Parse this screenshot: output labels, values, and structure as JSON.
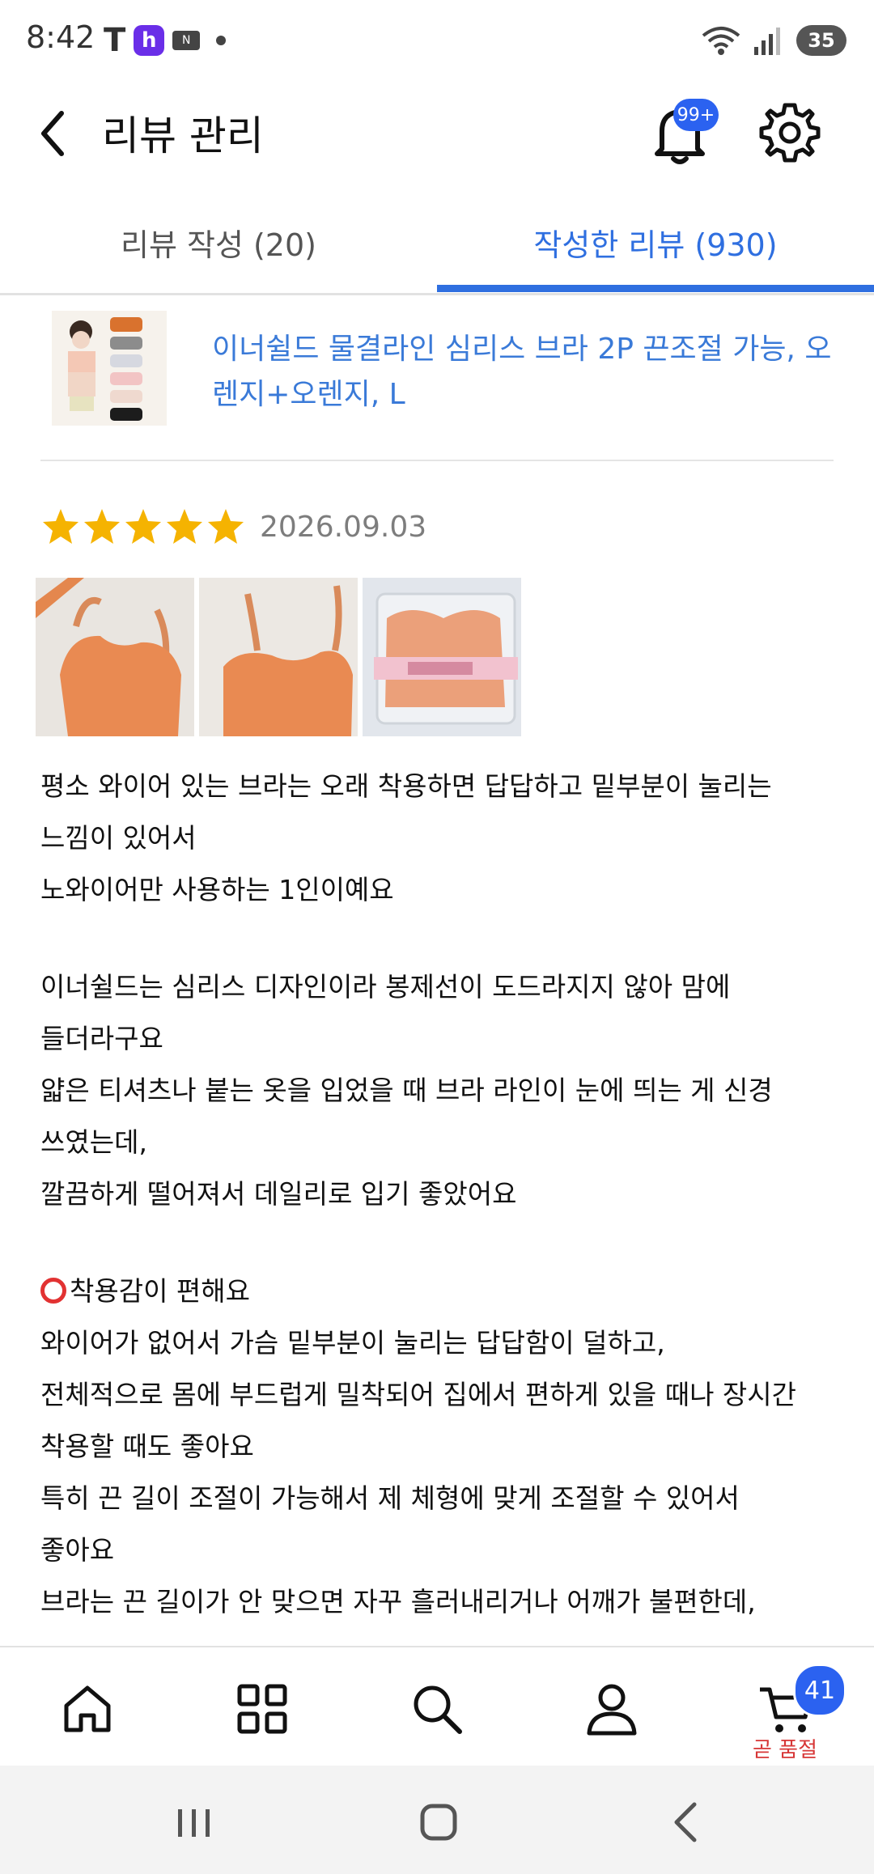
{
  "status_bar": {
    "time": "8:42",
    "t_glyph": "T",
    "h_glyph": "h",
    "nfc_glyph": "N",
    "battery": "35"
  },
  "header": {
    "title": "리뷰 관리",
    "notification_badge": "99+"
  },
  "tabs": [
    {
      "label": "리뷰 작성 (20)",
      "active": false
    },
    {
      "label": "작성한 리뷰 (930)",
      "active": true
    }
  ],
  "product": {
    "name": "이너쉴드 물결라인 심리스 브라 2P 끈조절 가능, 오렌지+오렌지, L"
  },
  "review": {
    "rating": 5,
    "date": "2026.09.03",
    "lines": [
      "평소 와이어 있는 브라는 오래 착용하면 답답하고 밑부분이 눌리는",
      "느낌이 있어서",
      "노와이어만 사용하는 1인이예요",
      "",
      "이너쉴드는 심리스 디자인이라 봉제선이 도드라지지 않아 맘에",
      "들더라구요",
      "얇은 티셔츠나 붙는 옷을 입었을 때 브라 라인이 눈에 띄는 게 신경",
      "쓰였는데,",
      "깔끔하게 떨어져서 데일리로 입기 좋았어요",
      "",
      "착용감이 편해요",
      "와이어가 없어서 가슴 밑부분이 눌리는 답답함이 덜하고,",
      "전체적으로 몸에 부드럽게 밀착되어 집에서 편하게 있을 때나 장시간",
      "착용할 때도 좋아요",
      "특히 끈 길이 조절이 가능해서 제 체형에 맞게 조절할 수 있어서",
      "좋아요",
      "브라는 끈 길이가 안 맞으면 자꾸 흘러내리거나 어깨가 불편한데,"
    ]
  },
  "bottom_nav": {
    "items": [
      "home-icon",
      "category-icon",
      "search-icon",
      "mypage-icon",
      "cart-icon"
    ],
    "cart_count": "41",
    "cart_label": "곧 품절"
  },
  "colors": {
    "accent": "#2f6fe0",
    "badge": "#2b62f0",
    "star": "#f5b301",
    "alert": "#d73636"
  }
}
